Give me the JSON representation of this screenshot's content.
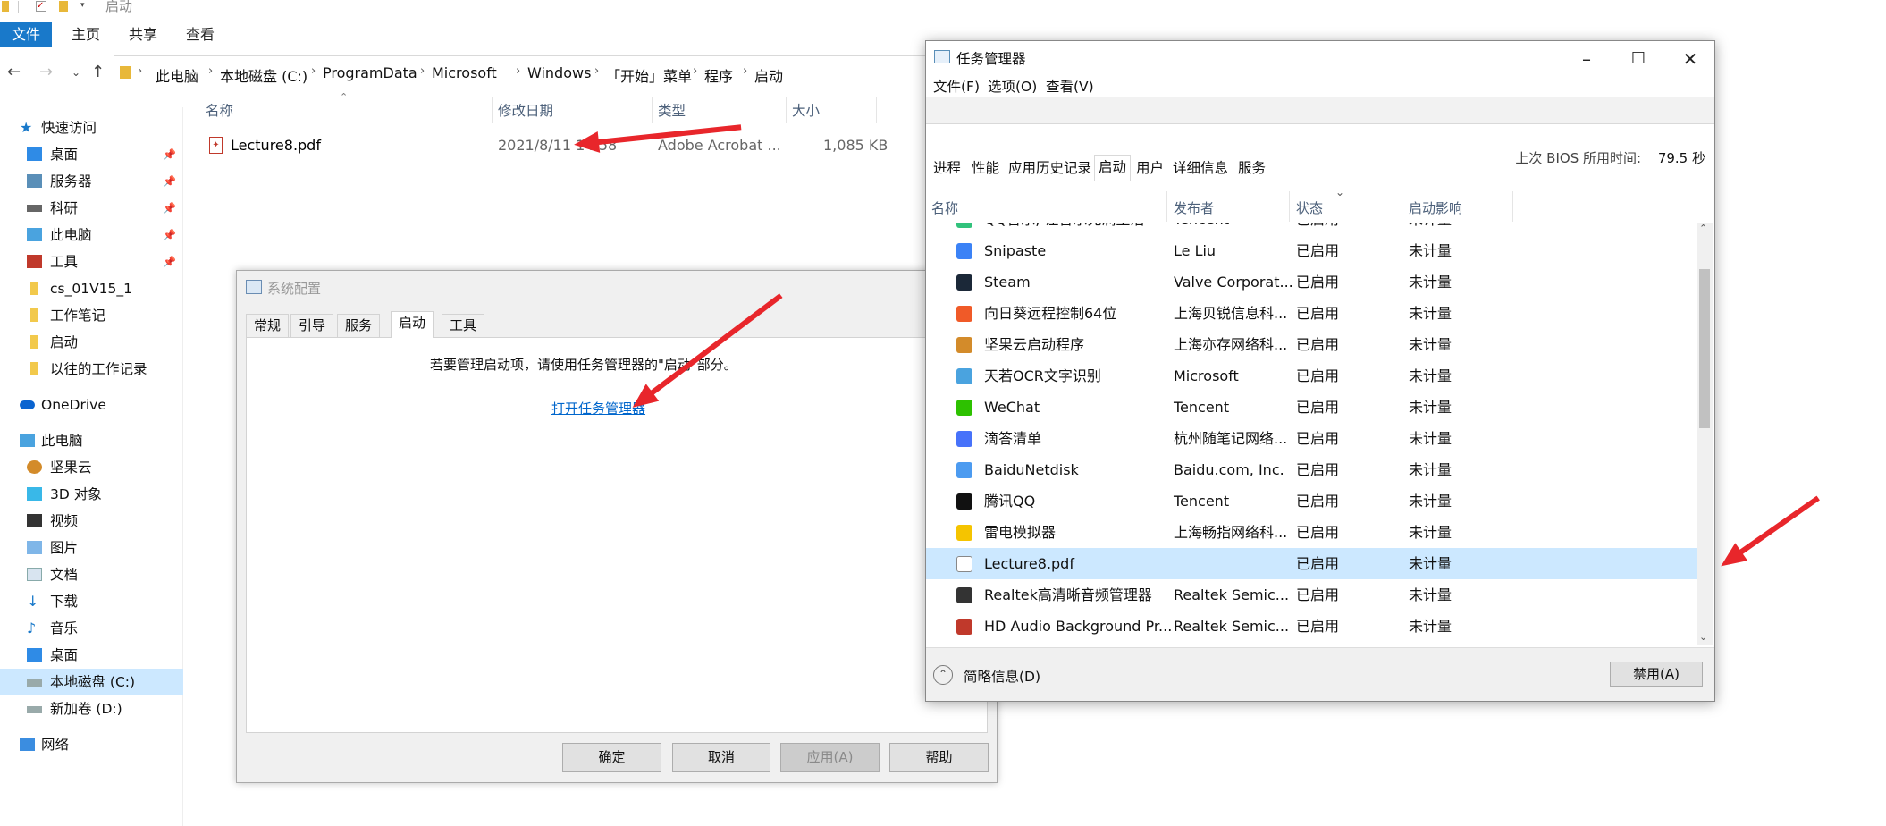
{
  "explorer": {
    "title": "启动",
    "ribbon_tabs": [
      "文件",
      "主页",
      "共享",
      "查看"
    ],
    "breadcrumbs": [
      "此电脑",
      "本地磁盘 (C:)",
      "ProgramData",
      "Microsoft",
      "Windows",
      "「开始」菜单",
      "程序",
      "启动"
    ],
    "columns": {
      "name": "名称",
      "modified": "修改日期",
      "type": "类型",
      "size": "大小"
    },
    "file": {
      "name": "Lecture8.pdf",
      "modified": "2021/8/11 14:58",
      "type": "Adobe Acrobat ...",
      "size": "1,085 KB"
    },
    "sidebar": {
      "quick_access": "快速访问",
      "quick_items": [
        "桌面",
        "服务器",
        "科研",
        "此电脑",
        "工具",
        "cs_01V15_1",
        "工作笔记",
        "启动",
        "以往的工作记录"
      ],
      "onedrive": "OneDrive",
      "this_pc": "此电脑",
      "pc_items": [
        "坚果云",
        "3D 对象",
        "视频",
        "图片",
        "文档",
        "下载",
        "音乐",
        "桌面",
        "本地磁盘 (C:)",
        "新加卷 (D:)"
      ],
      "network": "网络"
    }
  },
  "sysconfig": {
    "title": "系统配置",
    "tabs": [
      "常规",
      "引导",
      "服务",
      "启动",
      "工具"
    ],
    "message": "若要管理启动项，请使用任务管理器的\"启动\"部分。",
    "link": "打开任务管理器",
    "buttons": {
      "ok": "确定",
      "cancel": "取消",
      "apply": "应用(A)",
      "help": "帮助"
    }
  },
  "taskmgr": {
    "title": "任务管理器",
    "menu": [
      "文件(F)",
      "选项(O)",
      "查看(V)"
    ],
    "tabs": [
      "进程",
      "性能",
      "应用历史记录",
      "启动",
      "用户",
      "详细信息",
      "服务"
    ],
    "bios_label": "上次 BIOS 所用时间:",
    "bios_value": "79.5 秒",
    "columns": {
      "name": "名称",
      "publisher": "发布者",
      "status": "状态",
      "impact": "启动影响"
    },
    "rows": [
      {
        "name": "QQ音乐, 让音乐充满生活",
        "publisher": "Tencent",
        "status": "已启用",
        "impact": "未计量",
        "color": "#31c27c"
      },
      {
        "name": "Snipaste",
        "publisher": "Le Liu",
        "status": "已启用",
        "impact": "未计量",
        "color": "#3b82f6"
      },
      {
        "name": "Steam",
        "publisher": "Valve Corporat...",
        "status": "已启用",
        "impact": "未计量",
        "color": "#1b2838"
      },
      {
        "name": "向日葵远程控制64位",
        "publisher": "上海贝锐信息科...",
        "status": "已启用",
        "impact": "未计量",
        "color": "#f05a28"
      },
      {
        "name": "坚果云启动程序",
        "publisher": "上海亦存网络科...",
        "status": "已启用",
        "impact": "未计量",
        "color": "#d38b2a"
      },
      {
        "name": "天若OCR文字识别",
        "publisher": "Microsoft",
        "status": "已启用",
        "impact": "未计量",
        "color": "#4aa3df"
      },
      {
        "name": "WeChat",
        "publisher": "Tencent",
        "status": "已启用",
        "impact": "未计量",
        "color": "#2dc100"
      },
      {
        "name": "滴答清单",
        "publisher": "杭州随笔记网络...",
        "status": "已启用",
        "impact": "未计量",
        "color": "#4772fa"
      },
      {
        "name": "BaiduNetdisk",
        "publisher": "Baidu.com, Inc.",
        "status": "已启用",
        "impact": "未计量",
        "color": "#4c9bf0"
      },
      {
        "name": "腾讯QQ",
        "publisher": "Tencent",
        "status": "已启用",
        "impact": "未计量",
        "color": "#111111"
      },
      {
        "name": "雷电模拟器",
        "publisher": "上海畅指网络科...",
        "status": "已启用",
        "impact": "未计量",
        "color": "#f5c400"
      },
      {
        "name": "Lecture8.pdf",
        "publisher": "",
        "status": "已启用",
        "impact": "未计量",
        "color": "#ffffff"
      },
      {
        "name": "Realtek高清晰音频管理器",
        "publisher": "Realtek Semic...",
        "status": "已启用",
        "impact": "未计量",
        "color": "#333333"
      },
      {
        "name": "HD Audio Background Pr...",
        "publisher": "Realtek Semic...",
        "status": "已启用",
        "impact": "未计量",
        "color": "#c0392b"
      }
    ],
    "selected_row": 11,
    "footer_less": "简略信息(D)",
    "disable_button": "禁用(A)"
  }
}
